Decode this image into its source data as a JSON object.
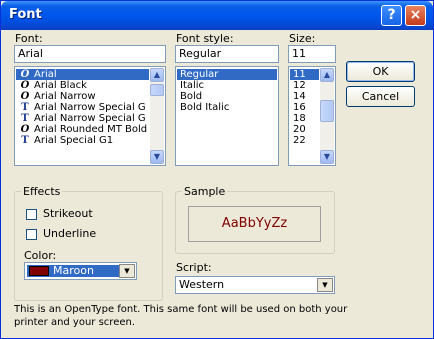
{
  "window": {
    "title": "Font"
  },
  "titlebar": {
    "help_glyph": "?",
    "close_glyph": "×"
  },
  "font": {
    "label": "Font:",
    "value": "Arial",
    "items": [
      "Arial",
      "Arial Black",
      "Arial Narrow",
      "Arial Narrow Special G",
      "Arial Narrow Special G",
      "Arial Rounded MT Bold",
      "Arial Special G1"
    ],
    "item_icons": [
      "opentype-icon",
      "opentype-icon",
      "opentype-icon",
      "truetype-icon",
      "truetype-icon",
      "opentype-icon",
      "truetype-icon"
    ],
    "icon_glyphs": {
      "opentype": "O",
      "truetype": "T"
    },
    "selected_index": 0
  },
  "style": {
    "label": "Font style:",
    "value": "Regular",
    "items": [
      "Regular",
      "Italic",
      "Bold",
      "Bold Italic"
    ],
    "selected_index": 0
  },
  "size": {
    "label": "Size:",
    "value": "11",
    "items": [
      "11",
      "12",
      "14",
      "16",
      "18",
      "20",
      "22"
    ],
    "selected_index": 0
  },
  "buttons": {
    "ok": "OK",
    "cancel": "Cancel"
  },
  "effects": {
    "label": "Effects",
    "strikeout": "Strikeout",
    "underline": "Underline",
    "strikeout_checked": false,
    "underline_checked": false,
    "color_label": "Color:",
    "color_value": "Maroon",
    "color_swatch": "#800000"
  },
  "sample": {
    "label": "Sample",
    "text": "AaBbYyZz",
    "color": "#800000"
  },
  "script": {
    "label": "Script:",
    "value": "Western"
  },
  "info": {
    "line1": "This is an OpenType font. This same font will be used on both your",
    "line2": "printer and your screen."
  },
  "scroll_glyphs": {
    "up": "▲",
    "down": "▼"
  }
}
